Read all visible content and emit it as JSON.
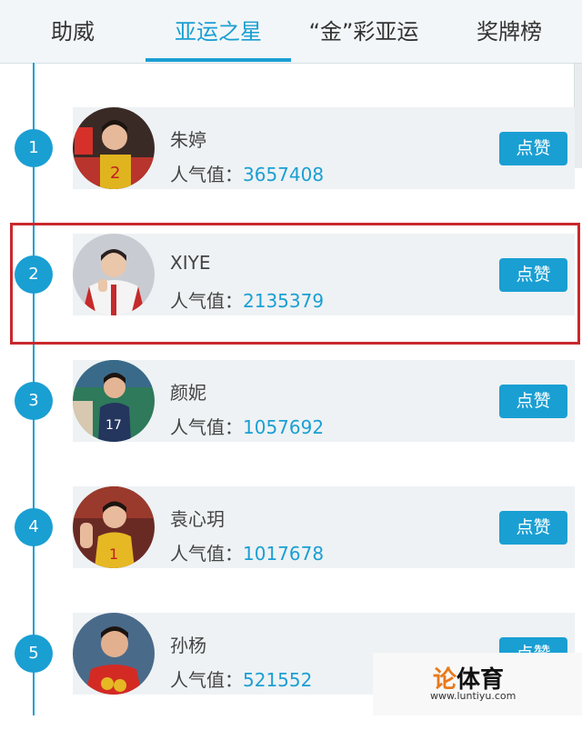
{
  "tabs": [
    {
      "label": "助威",
      "active": false
    },
    {
      "label": "亚运之星",
      "active": true
    },
    {
      "label": "“金”彩亚运",
      "active": false
    },
    {
      "label": "奖牌榜",
      "active": false
    }
  ],
  "colors": {
    "accent": "#1a9fd3",
    "highlight_border": "#c9282d",
    "card_bg": "#eef2f4"
  },
  "popularity_label": "人气值：",
  "like_label": "点赞",
  "rows": [
    {
      "rank": "1",
      "name": "朱婷",
      "popularity": "3657408",
      "avatar": "volleyball player in red jersey number 2"
    },
    {
      "rank": "2",
      "name": "XIYE",
      "popularity": "2135379",
      "avatar": "man in white and red jacket"
    },
    {
      "rank": "3",
      "name": "颜妮",
      "popularity": "1057692",
      "avatar": "volleyball player in navy jersey number 17"
    },
    {
      "rank": "4",
      "name": "袁心玥",
      "popularity": "1017678",
      "avatar": "volleyball player in yellow jersey number 1"
    },
    {
      "rank": "5",
      "name": "孙杨",
      "popularity": "521552",
      "avatar": "swimmer with medals"
    }
  ],
  "watermark": {
    "logo_part1": "论",
    "logo_part2": "体育",
    "url": "www.luntiyu.com"
  }
}
